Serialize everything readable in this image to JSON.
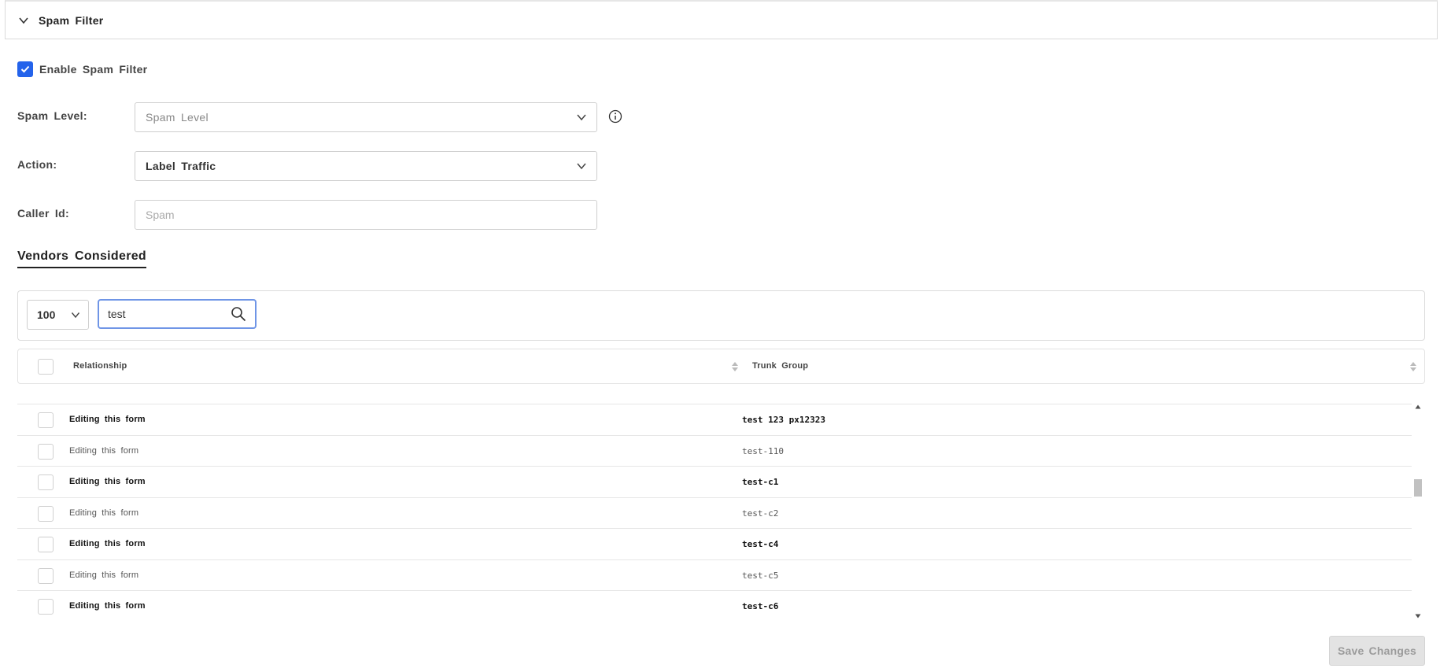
{
  "section": {
    "title": "Spam Filter"
  },
  "enable": {
    "label": "Enable Spam Filter",
    "checked": true
  },
  "spam_level": {
    "label": "Spam Level:",
    "value": "Spam Level"
  },
  "action": {
    "label": "Action:",
    "value": "Label Traffic"
  },
  "caller_id": {
    "label": "Caller Id:",
    "placeholder": "Spam"
  },
  "vendors": {
    "title": "Vendors Considered"
  },
  "toolbar": {
    "page_size": "100",
    "search_value": "test"
  },
  "table": {
    "columns": [
      "Relationship",
      "Trunk Group"
    ],
    "rows": [
      {
        "relationship": "Editing this form",
        "trunk_group": "test 123 px12323"
      },
      {
        "relationship": "Editing this form",
        "trunk_group": "test-110"
      },
      {
        "relationship": "Editing this form",
        "trunk_group": "test-c1"
      },
      {
        "relationship": "Editing this form",
        "trunk_group": "test-c2"
      },
      {
        "relationship": "Editing this form",
        "trunk_group": "test-c4"
      },
      {
        "relationship": "Editing this form",
        "trunk_group": "test-c5"
      },
      {
        "relationship": "Editing this form",
        "trunk_group": "test-c6"
      }
    ]
  },
  "footer": {
    "save_label": "Save Changes",
    "save_disabled": true
  },
  "colors": {
    "accent": "#2463eb",
    "border": "#cfcfcf",
    "disabled_bg": "#e3e3e3"
  }
}
